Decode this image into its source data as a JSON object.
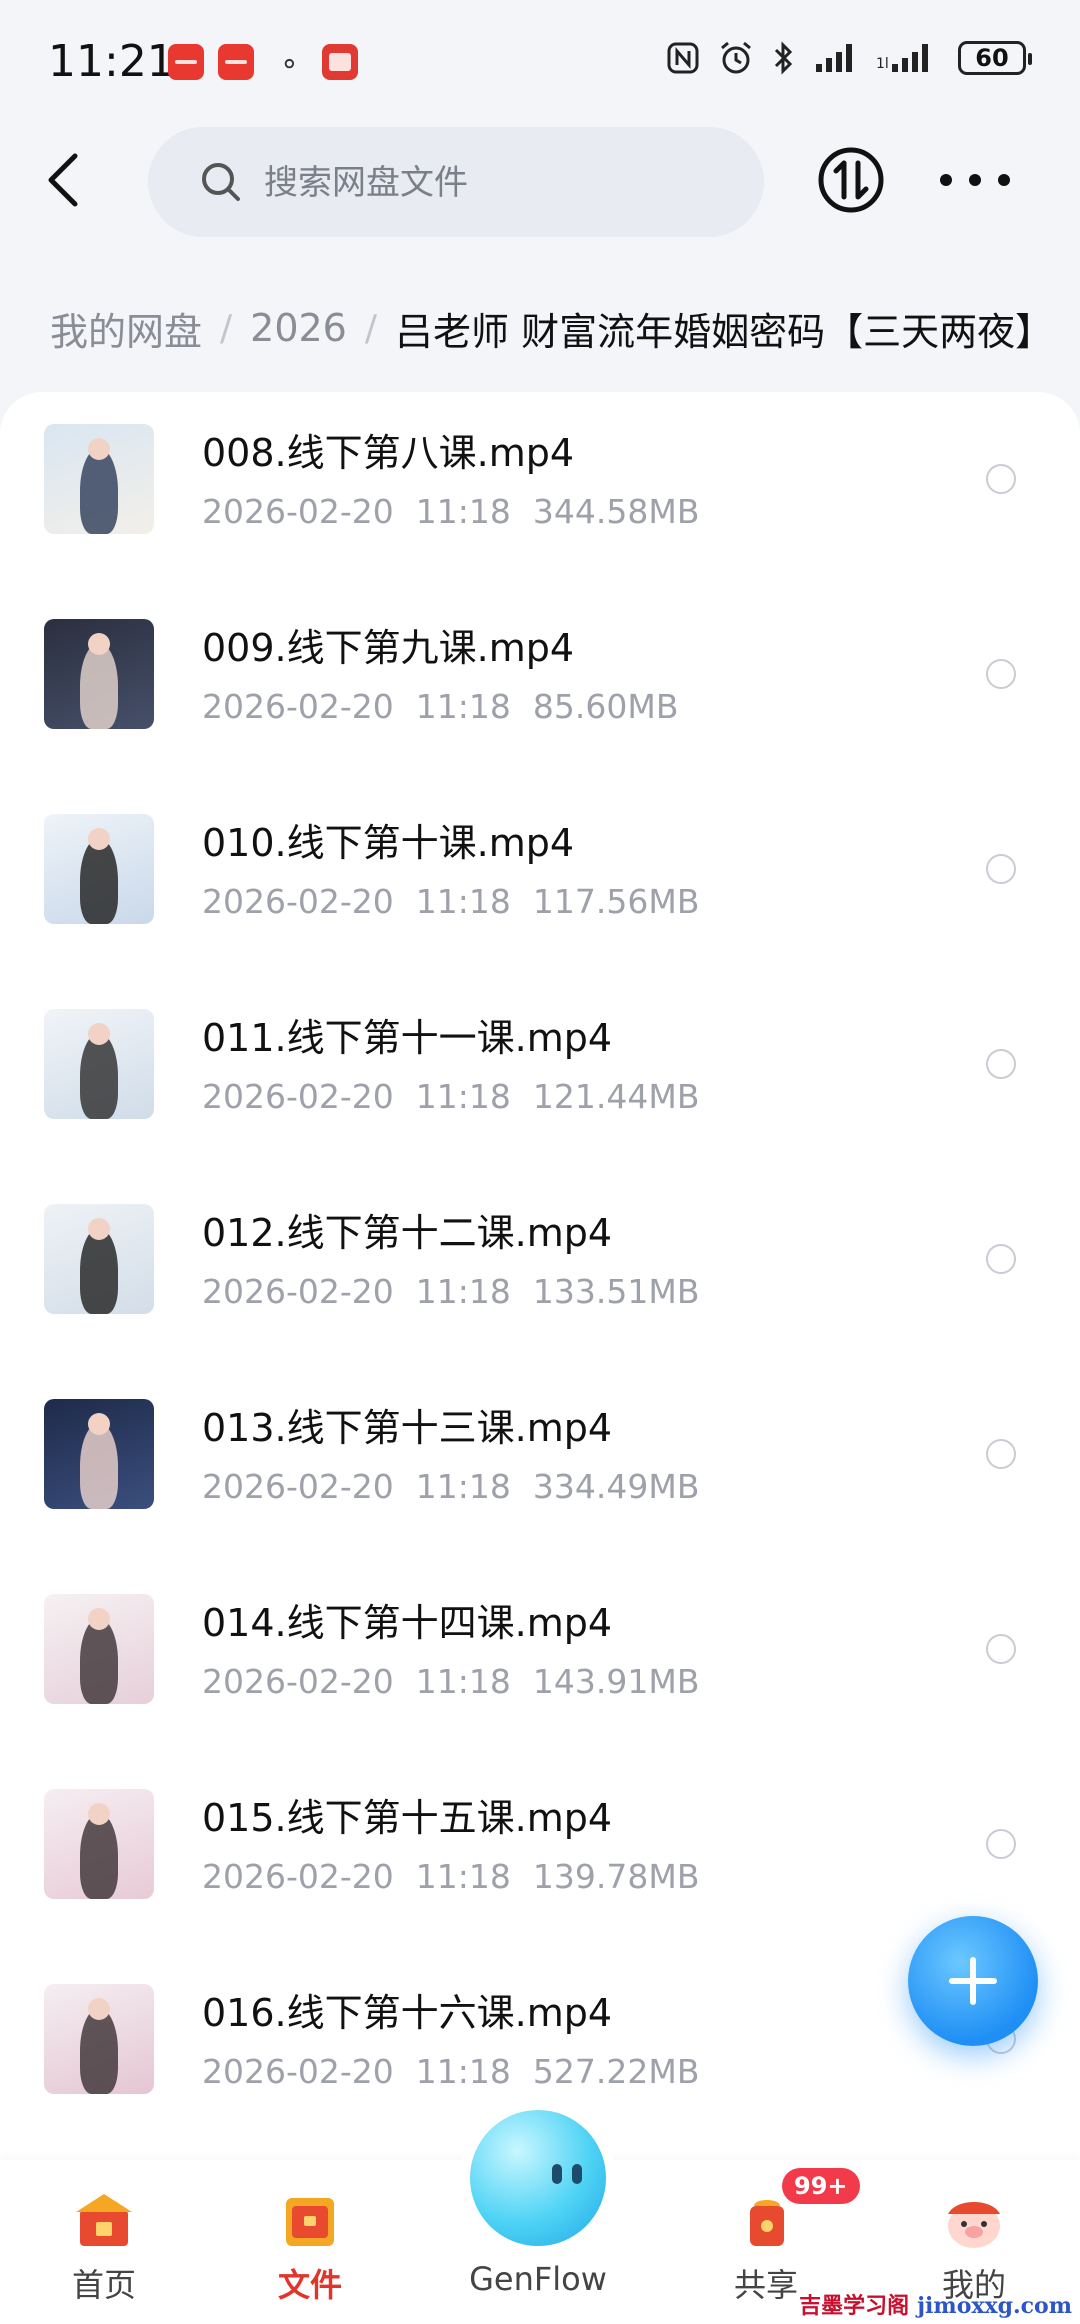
{
  "status_bar": {
    "time": "11:21",
    "battery": "60"
  },
  "search": {
    "placeholder": "搜索网盘文件"
  },
  "breadcrumb": {
    "root": "我的网盘",
    "year": "2026",
    "current": "吕老师 财富流年婚姻密码【三天两夜】"
  },
  "files": [
    {
      "name": "008.线下第八课.mp4",
      "date": "2026-02-20",
      "time": "11:18",
      "size": "344.58MB"
    },
    {
      "name": "009.线下第九课.mp4",
      "date": "2026-02-20",
      "time": "11:18",
      "size": "85.60MB"
    },
    {
      "name": "010.线下第十课.mp4",
      "date": "2026-02-20",
      "time": "11:18",
      "size": "117.56MB"
    },
    {
      "name": "011.线下第十一课.mp4",
      "date": "2026-02-20",
      "time": "11:18",
      "size": "121.44MB"
    },
    {
      "name": "012.线下第十二课.mp4",
      "date": "2026-02-20",
      "time": "11:18",
      "size": "133.51MB"
    },
    {
      "name": "013.线下第十三课.mp4",
      "date": "2026-02-20",
      "time": "11:18",
      "size": "334.49MB"
    },
    {
      "name": "014.线下第十四课.mp4",
      "date": "2026-02-20",
      "time": "11:18",
      "size": "143.91MB"
    },
    {
      "name": "015.线下第十五课.mp4",
      "date": "2026-02-20",
      "time": "11:18",
      "size": "139.78MB"
    },
    {
      "name": "016.线下第十六课.mp4",
      "date": "2026-02-20",
      "time": "11:18",
      "size": "527.22MB"
    }
  ],
  "nav": {
    "home": "首页",
    "files": "文件",
    "genflow": "GenFlow",
    "share": "共享",
    "share_badge": "99+",
    "me": "我的"
  },
  "watermark": {
    "text": "吉墨学习阁",
    "url": "jimoxxg.com"
  },
  "colors": {
    "accent": "#e2342b",
    "fab": "#1f8ff5",
    "meta_text": "#9ea1aa"
  }
}
